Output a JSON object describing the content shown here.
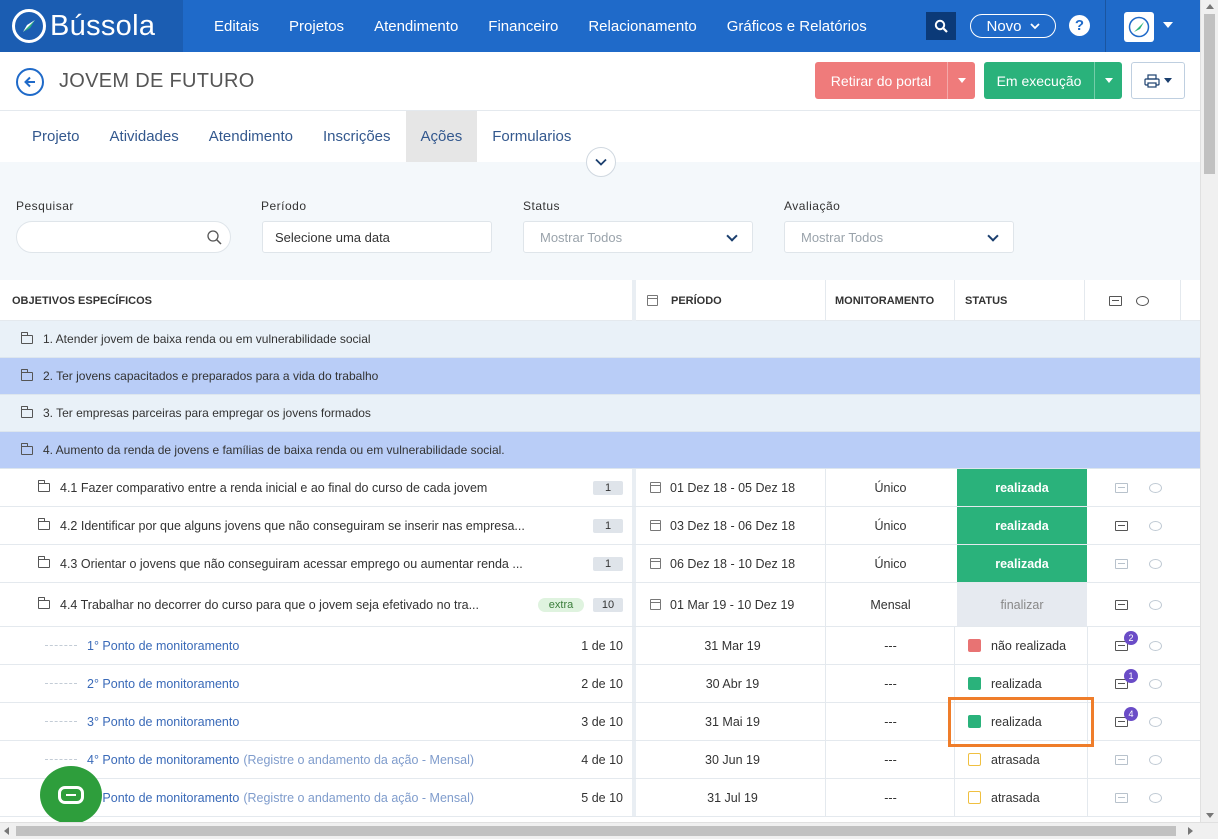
{
  "nav": {
    "brand": "Bússola",
    "items": [
      "Editais",
      "Projetos",
      "Atendimento",
      "Financeiro",
      "Relacionamento",
      "Gráficos e Relatórios"
    ],
    "novo_label": "Novo",
    "help_label": "?"
  },
  "header": {
    "title": "JOVEM DE FUTURO",
    "btn_retirar": "Retirar do portal",
    "btn_execucao": "Em execução"
  },
  "tabs": [
    "Projeto",
    "Atividades",
    "Atendimento",
    "Inscrições",
    "Ações",
    "Formularios"
  ],
  "active_tab": "Ações",
  "filters": {
    "search_label": "Pesquisar",
    "period_label": "Período",
    "period_value": "Selecione uma data",
    "status_label": "Status",
    "status_value": "Mostrar Todos",
    "eval_label": "Avaliação",
    "eval_value": "Mostrar Todos"
  },
  "table": {
    "headers": {
      "objetivos": "OBJETIVOS ESPECÍFICOS",
      "periodo": "PERÍODO",
      "monitoramento": "MONITORAMENTO",
      "status": "STATUS"
    },
    "groups": [
      "1. Atender jovem de baixa renda ou em vulnerabilidade social",
      "2. Ter jovens capacitados e preparados para a vida do trabalho",
      "3. Ter empresas parceiras para empregar os jovens formados",
      "4. Aumento da renda de jovens e famílias de baixa renda ou em vulnerabilidade social."
    ],
    "actions": [
      {
        "title": "4.1 Fazer comparativo entre a renda inicial e ao final do curso de cada jovem",
        "count": "1",
        "period": "01 Dez 18 - 05 Dez 18",
        "monitoring": "Único",
        "status": "realizada"
      },
      {
        "title": "4.2 Identificar por que alguns jovens que não conseguiram se inserir nas empresa...",
        "count": "1",
        "period": "03 Dez 18 - 06 Dez 18",
        "monitoring": "Único",
        "status": "realizada"
      },
      {
        "title": "4.3 Orientar o jovens que não conseguiram acessar emprego ou aumentar renda ...",
        "count": "1",
        "period": "06 Dez 18 - 10 Dez 18",
        "monitoring": "Único",
        "status": "realizada"
      },
      {
        "title": "4.4 Trabalhar no decorrer do curso para que o jovem seja efetivado no tra...",
        "extra": "extra",
        "count": "10",
        "period": "01 Mar 19 - 10 Dez 19",
        "monitoring": "Mensal",
        "status": "finalizar"
      }
    ],
    "points": [
      {
        "name": "1° Ponto de monitoramento",
        "hint": "",
        "progress": "1 de 10",
        "date": "31 Mar 19",
        "monitoring": "---",
        "status": "não realizada",
        "status_color": "#e87373",
        "badge": "2"
      },
      {
        "name": "2° Ponto de monitoramento",
        "hint": "",
        "progress": "2 de 10",
        "date": "30 Abr 19",
        "monitoring": "---",
        "status": "realizada",
        "status_color": "#2ab27b",
        "badge": "1"
      },
      {
        "name": "3° Ponto de monitoramento",
        "hint": "",
        "progress": "3 de 10",
        "date": "31 Mai 19",
        "monitoring": "---",
        "status": "realizada",
        "status_color": "#2ab27b",
        "badge": "4"
      },
      {
        "name": "4° Ponto de monitoramento",
        "hint": "(Registre o andamento da ação - Mensal)",
        "progress": "4 de 10",
        "date": "30 Jun 19",
        "monitoring": "---",
        "status": "atrasada",
        "status_color": "#f0c040",
        "badge": ""
      },
      {
        "name": "5° Ponto de monitoramento",
        "hint": "(Registre o andamento da ação - Mensal)",
        "progress": "5 de 10",
        "date": "31 Jul 19",
        "monitoring": "---",
        "status": "atrasada",
        "status_color": "#f0c040",
        "badge": ""
      }
    ]
  },
  "colors": {
    "nav_bg": "#1f6ac9",
    "green": "#2ab27b",
    "red": "#ef7b7b",
    "highlight": "#ef7d2a"
  }
}
